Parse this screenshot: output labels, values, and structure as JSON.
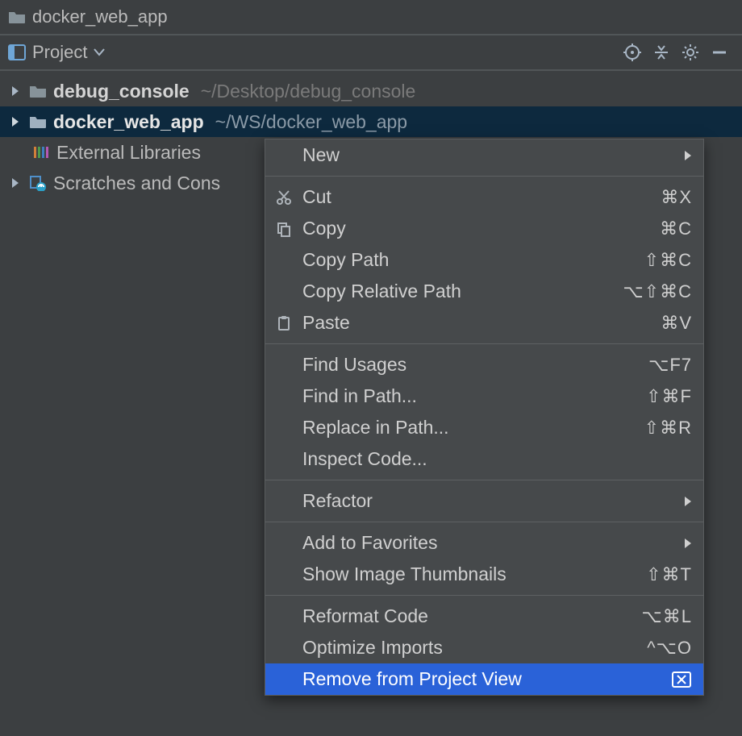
{
  "titlebar": {
    "title": "docker_web_app"
  },
  "toolbar": {
    "project_label": "Project"
  },
  "tree": {
    "items": [
      {
        "name": "debug_console",
        "path": "~/Desktop/debug_console",
        "kind": "folder",
        "expandable": true,
        "selected": false,
        "bold": true
      },
      {
        "name": "docker_web_app",
        "path": "~/WS/docker_web_app",
        "kind": "folder",
        "expandable": true,
        "selected": true,
        "bold": true
      },
      {
        "name": "External Libraries",
        "path": "",
        "kind": "libraries",
        "expandable": false,
        "selected": false,
        "bold": false
      },
      {
        "name": "Scratches and Cons",
        "path": "",
        "kind": "scratches",
        "expandable": true,
        "selected": false,
        "bold": false
      }
    ]
  },
  "menu": {
    "groups": [
      [
        {
          "label": "New",
          "shortcut": "",
          "icon": "",
          "submenu": true
        }
      ],
      [
        {
          "label": "Cut",
          "shortcut": "⌘X",
          "icon": "cut"
        },
        {
          "label": "Copy",
          "shortcut": "⌘C",
          "icon": "copy"
        },
        {
          "label": "Copy Path",
          "shortcut": "⇧⌘C",
          "icon": ""
        },
        {
          "label": "Copy Relative Path",
          "shortcut": "⌥⇧⌘C",
          "icon": ""
        },
        {
          "label": "Paste",
          "shortcut": "⌘V",
          "icon": "paste"
        }
      ],
      [
        {
          "label": "Find Usages",
          "shortcut": "⌥F7",
          "icon": ""
        },
        {
          "label": "Find in Path...",
          "shortcut": "⇧⌘F",
          "icon": ""
        },
        {
          "label": "Replace in Path...",
          "shortcut": "⇧⌘R",
          "icon": ""
        },
        {
          "label": "Inspect Code...",
          "shortcut": "",
          "icon": ""
        }
      ],
      [
        {
          "label": "Refactor",
          "shortcut": "",
          "icon": "",
          "submenu": true
        }
      ],
      [
        {
          "label": "Add to Favorites",
          "shortcut": "",
          "icon": "",
          "submenu": true
        },
        {
          "label": "Show Image Thumbnails",
          "shortcut": "⇧⌘T",
          "icon": ""
        }
      ],
      [
        {
          "label": "Reformat Code",
          "shortcut": "⌥⌘L",
          "icon": ""
        },
        {
          "label": "Optimize Imports",
          "shortcut": "^⌥O",
          "icon": ""
        },
        {
          "label": "Remove from Project View",
          "shortcut": "",
          "icon": "delete",
          "highlight": true
        }
      ]
    ]
  }
}
